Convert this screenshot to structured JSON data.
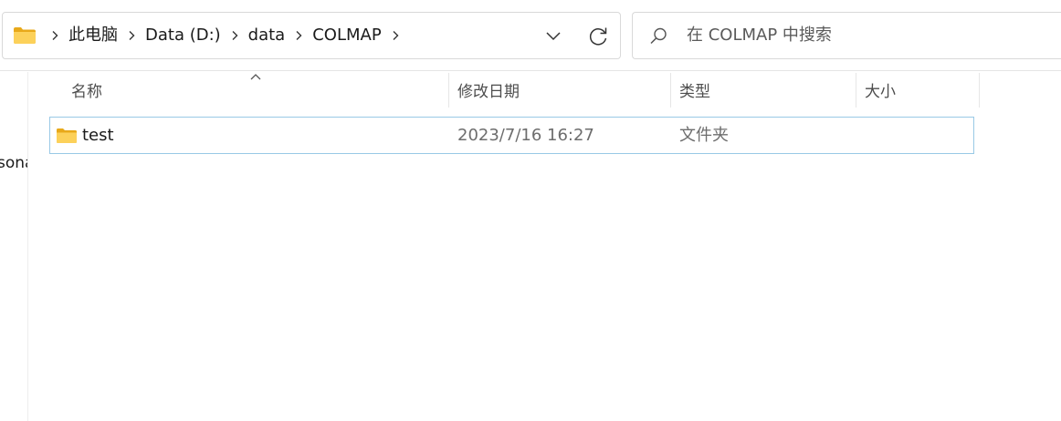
{
  "address": {
    "breadcrumbs": [
      "此电脑",
      "Data (D:)",
      "data",
      "COLMAP"
    ]
  },
  "search": {
    "placeholder": "在 COLMAP 中搜索"
  },
  "nav": {
    "partial_label": "sona"
  },
  "columns": {
    "name": "名称",
    "date": "修改日期",
    "type": "类型",
    "size": "大小"
  },
  "files": [
    {
      "name": "test",
      "modified": "2023/7/16 16:27",
      "type": "文件夹",
      "size": ""
    }
  ],
  "colors": {
    "selection_border": "#99c9e6",
    "folder_yellow": "#f7c948"
  }
}
